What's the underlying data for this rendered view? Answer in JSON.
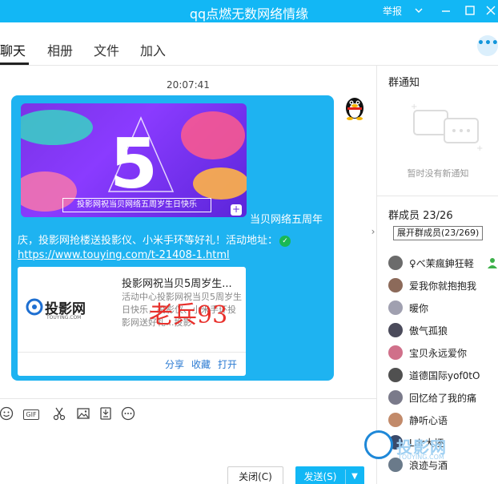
{
  "window": {
    "title": "qq点燃无数网络情缘",
    "report_label": "举报",
    "icons": [
      "chevron-down-icon",
      "minimize-icon",
      "maximize-icon",
      "close-icon"
    ]
  },
  "tabs": [
    {
      "label": "聊天",
      "active": true
    },
    {
      "label": "相册",
      "active": false
    },
    {
      "label": "文件",
      "active": false
    },
    {
      "label": "加入",
      "active": false
    }
  ],
  "more_label": "•••",
  "chat": {
    "timestamp": "20:07:41",
    "message": {
      "banner_text": "投影网祝当贝网络五周岁生日快乐",
      "line1": "当贝网络五周年",
      "line2": "庆，投影网抢楼送投影仪、小米手环等好礼！活动地址：",
      "link": "https://www.touying.com/t-21408-1.html",
      "card": {
        "logo_text": "投影网",
        "logo_sub": "TOUYING.COM",
        "title": "投影网祝当贝5周岁生...",
        "desc": "活动中心投影网祝当贝5周岁生日快乐，投影仪、小米手环投影网送好礼...投影",
        "actions": [
          "分享",
          "收藏",
          "打开"
        ]
      }
    },
    "watermark": "老兵93"
  },
  "toolbar": {
    "icons": [
      "emoji-icon",
      "gif-icon",
      "scissors-icon",
      "image-icon",
      "save-icon",
      "more-icon"
    ],
    "gif_label": "GIF"
  },
  "buttons": {
    "close": "关闭(C)",
    "send": "发送(S)"
  },
  "panel": {
    "notice_title": "群通知",
    "notice_empty": "暂时没有新通知",
    "members_title": "群成员 23/26",
    "tooltip": "展开群成员(23/269)",
    "members": [
      {
        "name": "♀べ茉瘋鉮狂軽",
        "color": "#6b6b6b"
      },
      {
        "name": "爱我你就抱抱我",
        "color": "#8c6a5a"
      },
      {
        "name": "暖你",
        "color": "#a0a0b0"
      },
      {
        "name": "傲气孤狼",
        "color": "#4b4b5b"
      },
      {
        "name": "宝贝永远爱你",
        "color": "#d0708a"
      },
      {
        "name": "道德国际yof0tO",
        "color": "#505050"
      },
      {
        "name": "回忆给了我的痛",
        "color": "#7a7a8a"
      },
      {
        "name": "静听心语",
        "color": "#c28a6a"
      },
      {
        "name": "Ldr大坯",
        "color": "#3a4a6a"
      },
      {
        "name": "浪迹与酒",
        "color": "#6a7a8a"
      }
    ],
    "site_logo": "投影网",
    "site_logo_sub": "TOUYING.COM"
  }
}
